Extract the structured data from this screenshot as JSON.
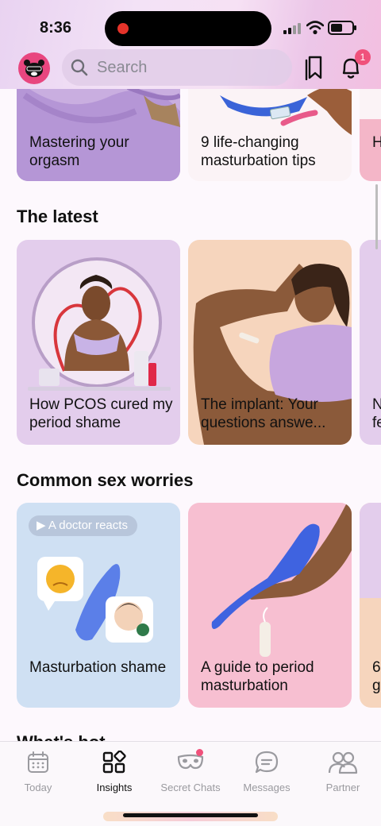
{
  "status": {
    "time": "8:36"
  },
  "search": {
    "placeholder": "Search"
  },
  "notifications": {
    "count": "1"
  },
  "top_row": [
    {
      "title": "Mastering your orgasm"
    },
    {
      "title": "9 life-changing masturbation tips"
    },
    {
      "title": "H..."
    }
  ],
  "latest": {
    "heading": "The latest",
    "cards": [
      {
        "title": "How PCOS cured my period shame"
      },
      {
        "title": "The implant: Your questions answe..."
      },
      {
        "title": "N... fe..."
      }
    ]
  },
  "worries": {
    "heading": "Common sex worries",
    "cards": [
      {
        "pill": "A doctor reacts",
        "title": "Masturbation shame"
      },
      {
        "title": "A guide to period masturbation"
      },
      {
        "title": "6 g"
      }
    ]
  },
  "next_heading": "What's hot",
  "tabs": [
    {
      "label": "Today",
      "icon": "calendar-icon"
    },
    {
      "label": "Insights",
      "icon": "grid-icon"
    },
    {
      "label": "Secret Chats",
      "icon": "mask-icon"
    },
    {
      "label": "Messages",
      "icon": "chat-bubble-icon"
    },
    {
      "label": "Partner",
      "icon": "partner-icon"
    }
  ],
  "colors": {
    "accent": "#f0517b",
    "avatar_bg": "#e8467f",
    "card_lilac": "#e3cdec",
    "card_peach": "#f6d5bd",
    "card_blue": "#cfe0f3",
    "card_pink": "#f7bfd1"
  }
}
